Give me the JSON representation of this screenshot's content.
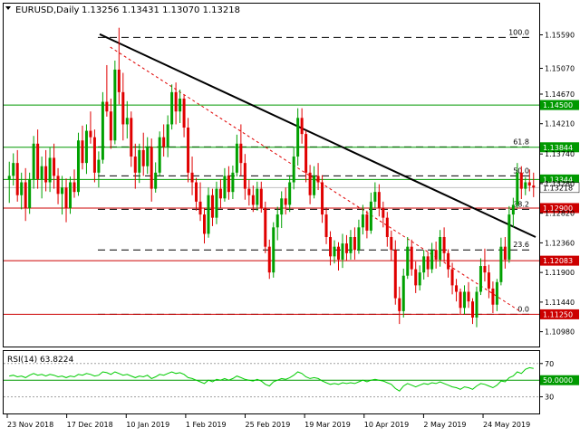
{
  "header": {
    "symbol_timeframe": "EURUSD,Daily",
    "ohlc": "1.13256 1.13431 1.13070 1.13218"
  },
  "colors": {
    "bull": "#00a000",
    "bear": "#e00000",
    "grid": "#d0d0d0",
    "fib": "#000000",
    "hline_green": "#009900",
    "hline_red": "#cc0000",
    "trend": "#000000",
    "rsi": "#00cc00",
    "rsi_level": "#009900"
  },
  "chart_data": [
    {
      "type": "candlestick",
      "y_axis_ticks": [
        "1.15590",
        "1.15070",
        "1.14670",
        "1.14210",
        "1.13740",
        "1.13280",
        "1.12820",
        "1.12360",
        "1.11900",
        "1.11440",
        "1.10980"
      ],
      "ylim": [
        1.1075,
        1.1585
      ],
      "x_axis_labels": [
        "23 Nov 2018",
        "17 Dec 2018",
        "10 Jan 2019",
        "1 Feb 2019",
        "25 Feb 2019",
        "19 Mar 2019",
        "10 Apr 2019",
        "2 May 2019",
        "24 May 2019"
      ],
      "fib_levels": [
        {
          "label": "100.0",
          "value": 1.1555
        },
        {
          "label": "61.8",
          "value": 1.1385
        },
        {
          "label": "50.0",
          "value": 1.134
        },
        {
          "label": "38.2",
          "value": 1.1288
        },
        {
          "label": "23.6",
          "value": 1.1225
        },
        {
          "label": "0.0",
          "value": 1.1125
        }
      ],
      "horizontal_levels": [
        {
          "label": "1.14500",
          "value": 1.145,
          "color": "green"
        },
        {
          "label": "1.13844",
          "value": 1.13844,
          "color": "green"
        },
        {
          "label": "1.13344",
          "value": 1.13344,
          "color": "green"
        },
        {
          "label": "1.12900",
          "value": 1.129,
          "color": "red"
        },
        {
          "label": "1.12083",
          "value": 1.12083,
          "color": "red"
        },
        {
          "label": "1.11250",
          "value": 1.1125,
          "color": "red"
        }
      ],
      "current_price": {
        "label": "1.13218",
        "value": 1.13218
      },
      "trendline": {
        "from": [
          0.175,
          1.156
        ],
        "to": [
          1.0,
          1.1245
        ]
      },
      "dashed_trendline": {
        "from": [
          0.195,
          1.154
        ],
        "to": [
          0.97,
          1.113
        ]
      },
      "candles_ohlc": [
        [
          1.1335,
          1.1362,
          1.1298,
          1.134
        ],
        [
          1.134,
          1.1375,
          1.1325,
          1.136
        ],
        [
          1.136,
          1.138,
          1.13,
          1.131
        ],
        [
          1.131,
          1.1345,
          1.1288,
          1.133
        ],
        [
          1.133,
          1.1352,
          1.127,
          1.129
        ],
        [
          1.129,
          1.1345,
          1.1281,
          1.1335
        ],
        [
          1.1335,
          1.1402,
          1.132,
          1.139
        ],
        [
          1.139,
          1.1412,
          1.132,
          1.1335
        ],
        [
          1.1335,
          1.137,
          1.1305,
          1.1355
        ],
        [
          1.1355,
          1.138,
          1.1316,
          1.133
        ],
        [
          1.133,
          1.1384,
          1.1315,
          1.1368
        ],
        [
          1.1368,
          1.139,
          1.132,
          1.134
        ],
        [
          1.134,
          1.1352,
          1.1296,
          1.1312
        ],
        [
          1.1312,
          1.134,
          1.128,
          1.1322
        ],
        [
          1.1322,
          1.1336,
          1.1268,
          1.129
        ],
        [
          1.129,
          1.1339,
          1.1281,
          1.133
        ],
        [
          1.133,
          1.135,
          1.1306,
          1.1315
        ],
        [
          1.1315,
          1.1407,
          1.1309,
          1.1395
        ],
        [
          1.1395,
          1.1418,
          1.135,
          1.136
        ],
        [
          1.136,
          1.142,
          1.1343,
          1.141
        ],
        [
          1.141,
          1.144,
          1.139,
          1.14
        ],
        [
          1.14,
          1.1412,
          1.133,
          1.1345
        ],
        [
          1.1345,
          1.1378,
          1.1322,
          1.1365
        ],
        [
          1.1365,
          1.147,
          1.1359,
          1.1455
        ],
        [
          1.1455,
          1.1512,
          1.1432,
          1.144
        ],
        [
          1.144,
          1.146,
          1.1382,
          1.1395
        ],
        [
          1.1395,
          1.1519,
          1.1389,
          1.1505
        ],
        [
          1.1505,
          1.157,
          1.1451,
          1.147
        ],
        [
          1.147,
          1.15,
          1.1395,
          1.142
        ],
        [
          1.142,
          1.1456,
          1.1398,
          1.143
        ],
        [
          1.143,
          1.144,
          1.1354,
          1.137
        ],
        [
          1.137,
          1.139,
          1.132,
          1.1345
        ],
        [
          1.1345,
          1.139,
          1.1329,
          1.138
        ],
        [
          1.138,
          1.1407,
          1.134,
          1.1355
        ],
        [
          1.1355,
          1.14,
          1.1343,
          1.1385
        ],
        [
          1.1385,
          1.1398,
          1.13,
          1.132
        ],
        [
          1.132,
          1.1361,
          1.1314,
          1.1345
        ],
        [
          1.1345,
          1.1409,
          1.1339,
          1.14
        ],
        [
          1.14,
          1.142,
          1.137,
          1.1385
        ],
        [
          1.1385,
          1.1434,
          1.1369,
          1.142
        ],
        [
          1.142,
          1.1482,
          1.1412,
          1.147
        ],
        [
          1.147,
          1.1485,
          1.142,
          1.144
        ],
        [
          1.144,
          1.1474,
          1.1422,
          1.146
        ],
        [
          1.146,
          1.1466,
          1.14,
          1.1415
        ],
        [
          1.1415,
          1.143,
          1.133,
          1.1345
        ],
        [
          1.1345,
          1.137,
          1.131,
          1.133
        ],
        [
          1.133,
          1.1337,
          1.1286,
          1.13
        ],
        [
          1.13,
          1.133,
          1.127,
          1.128
        ],
        [
          1.128,
          1.129,
          1.1235,
          1.125
        ],
        [
          1.125,
          1.1322,
          1.1244,
          1.131
        ],
        [
          1.131,
          1.132,
          1.1262,
          1.1275
        ],
        [
          1.1275,
          1.1331,
          1.1265,
          1.132
        ],
        [
          1.132,
          1.1335,
          1.129,
          1.1305
        ],
        [
          1.1305,
          1.1352,
          1.13,
          1.134
        ],
        [
          1.134,
          1.1355,
          1.1303,
          1.1315
        ],
        [
          1.1315,
          1.1356,
          1.1304,
          1.1345
        ],
        [
          1.1345,
          1.1404,
          1.1339,
          1.139
        ],
        [
          1.139,
          1.142,
          1.134,
          1.136
        ],
        [
          1.136,
          1.1374,
          1.1303,
          1.132
        ],
        [
          1.132,
          1.1334,
          1.1294,
          1.131
        ],
        [
          1.131,
          1.1325,
          1.1284,
          1.1295
        ],
        [
          1.1295,
          1.1331,
          1.1286,
          1.132
        ],
        [
          1.132,
          1.1331,
          1.1283,
          1.129
        ],
        [
          1.129,
          1.13,
          1.122,
          1.123
        ],
        [
          1.123,
          1.1241,
          1.118,
          1.119
        ],
        [
          1.119,
          1.1268,
          1.1182,
          1.126
        ],
        [
          1.126,
          1.1292,
          1.124,
          1.128
        ],
        [
          1.128,
          1.1316,
          1.1259,
          1.1305
        ],
        [
          1.1305,
          1.1322,
          1.128,
          1.1295
        ],
        [
          1.1295,
          1.1341,
          1.1284,
          1.133
        ],
        [
          1.133,
          1.1384,
          1.1319,
          1.137
        ],
        [
          1.137,
          1.1445,
          1.1356,
          1.143
        ],
        [
          1.143,
          1.1445,
          1.139,
          1.1405
        ],
        [
          1.1405,
          1.141,
          1.133,
          1.1345
        ],
        [
          1.1345,
          1.1357,
          1.1296,
          1.131
        ],
        [
          1.131,
          1.1355,
          1.1305,
          1.134
        ],
        [
          1.134,
          1.136,
          1.1318,
          1.133
        ],
        [
          1.133,
          1.1341,
          1.1267,
          1.128
        ],
        [
          1.128,
          1.1291,
          1.1234,
          1.1245
        ],
        [
          1.1245,
          1.1254,
          1.1201,
          1.1215
        ],
        [
          1.1215,
          1.124,
          1.1204,
          1.123
        ],
        [
          1.123,
          1.1237,
          1.1193,
          1.121
        ],
        [
          1.121,
          1.125,
          1.1197,
          1.1235
        ],
        [
          1.1235,
          1.1248,
          1.1208,
          1.122
        ],
        [
          1.122,
          1.1256,
          1.121,
          1.1245
        ],
        [
          1.1245,
          1.126,
          1.121,
          1.1225
        ],
        [
          1.1225,
          1.1272,
          1.1219,
          1.126
        ],
        [
          1.126,
          1.1295,
          1.1249,
          1.128
        ],
        [
          1.128,
          1.1286,
          1.1243,
          1.1255
        ],
        [
          1.1255,
          1.1314,
          1.125,
          1.13
        ],
        [
          1.13,
          1.133,
          1.129,
          1.1315
        ],
        [
          1.1315,
          1.1327,
          1.1277,
          1.129
        ],
        [
          1.129,
          1.13,
          1.126,
          1.1275
        ],
        [
          1.1275,
          1.1284,
          1.123,
          1.1245
        ],
        [
          1.1245,
          1.1255,
          1.1208,
          1.1225
        ],
        [
          1.1225,
          1.124,
          1.114,
          1.115
        ],
        [
          1.115,
          1.1168,
          1.111,
          1.113
        ],
        [
          1.113,
          1.1196,
          1.112,
          1.1185
        ],
        [
          1.1185,
          1.1245,
          1.118,
          1.123
        ],
        [
          1.123,
          1.1241,
          1.1185,
          1.1195
        ],
        [
          1.1195,
          1.1207,
          1.1158,
          1.117
        ],
        [
          1.117,
          1.1201,
          1.1162,
          1.119
        ],
        [
          1.119,
          1.1225,
          1.1179,
          1.1215
        ],
        [
          1.1215,
          1.1222,
          1.1183,
          1.1195
        ],
        [
          1.1195,
          1.1236,
          1.1189,
          1.1225
        ],
        [
          1.1225,
          1.1238,
          1.1196,
          1.121
        ],
        [
          1.121,
          1.1256,
          1.1199,
          1.1245
        ],
        [
          1.1245,
          1.126,
          1.1207,
          1.122
        ],
        [
          1.122,
          1.1226,
          1.1182,
          1.1195
        ],
        [
          1.1195,
          1.1205,
          1.1156,
          1.117
        ],
        [
          1.117,
          1.118,
          1.1145,
          1.116
        ],
        [
          1.116,
          1.1165,
          1.1125,
          1.1135
        ],
        [
          1.1135,
          1.117,
          1.1125,
          1.116
        ],
        [
          1.116,
          1.1175,
          1.1135,
          1.1145
        ],
        [
          1.1145,
          1.115,
          1.111,
          1.112
        ],
        [
          1.112,
          1.1168,
          1.1105,
          1.116
        ],
        [
          1.116,
          1.1212,
          1.1155,
          1.12
        ],
        [
          1.12,
          1.1227,
          1.1176,
          1.119
        ],
        [
          1.119,
          1.1202,
          1.115,
          1.1165
        ],
        [
          1.1165,
          1.1176,
          1.1127,
          1.114
        ],
        [
          1.114,
          1.118,
          1.113,
          1.1175
        ],
        [
          1.1175,
          1.1244,
          1.117,
          1.123
        ],
        [
          1.123,
          1.1245,
          1.1196,
          1.121
        ],
        [
          1.121,
          1.1293,
          1.1205,
          1.128
        ],
        [
          1.128,
          1.1306,
          1.126,
          1.1295
        ],
        [
          1.1295,
          1.136,
          1.129,
          1.1345
        ],
        [
          1.1345,
          1.1355,
          1.1304,
          1.132
        ],
        [
          1.132,
          1.1338,
          1.131,
          1.133
        ],
        [
          1.133,
          1.135,
          1.1316,
          1.1325
        ],
        [
          1.1325,
          1.1345,
          1.1307,
          1.1322
        ]
      ]
    },
    {
      "type": "line",
      "title": "RSI(14) 63.8224",
      "y_axis_ticks": [
        "70",
        "50",
        "30"
      ],
      "ylim": [
        10,
        85
      ],
      "levels": [
        {
          "label": "50.0000",
          "value": 50
        }
      ],
      "values": [
        55,
        56,
        54,
        55,
        53,
        56,
        58,
        56,
        57,
        55,
        57,
        56,
        54,
        55,
        53,
        55,
        54,
        57,
        56,
        58,
        57,
        55,
        56,
        60,
        59,
        57,
        60,
        58,
        56,
        57,
        55,
        53,
        55,
        54,
        56,
        52,
        54,
        57,
        56,
        58,
        60,
        58,
        59,
        57,
        53,
        52,
        50,
        48,
        46,
        50,
        48,
        51,
        50,
        52,
        50,
        52,
        55,
        53,
        51,
        50,
        49,
        51,
        49,
        45,
        43,
        48,
        50,
        52,
        51,
        53,
        56,
        60,
        58,
        54,
        52,
        53,
        52,
        49,
        47,
        45,
        46,
        45,
        47,
        46,
        47,
        46,
        48,
        50,
        48,
        50,
        51,
        50,
        49,
        47,
        45,
        40,
        37,
        43,
        46,
        44,
        42,
        44,
        46,
        45,
        47,
        46,
        48,
        46,
        44,
        42,
        41,
        39,
        42,
        41,
        39,
        43,
        46,
        45,
        43,
        41,
        44,
        49,
        48,
        53,
        55,
        60,
        58,
        63,
        65,
        64
      ]
    }
  ]
}
